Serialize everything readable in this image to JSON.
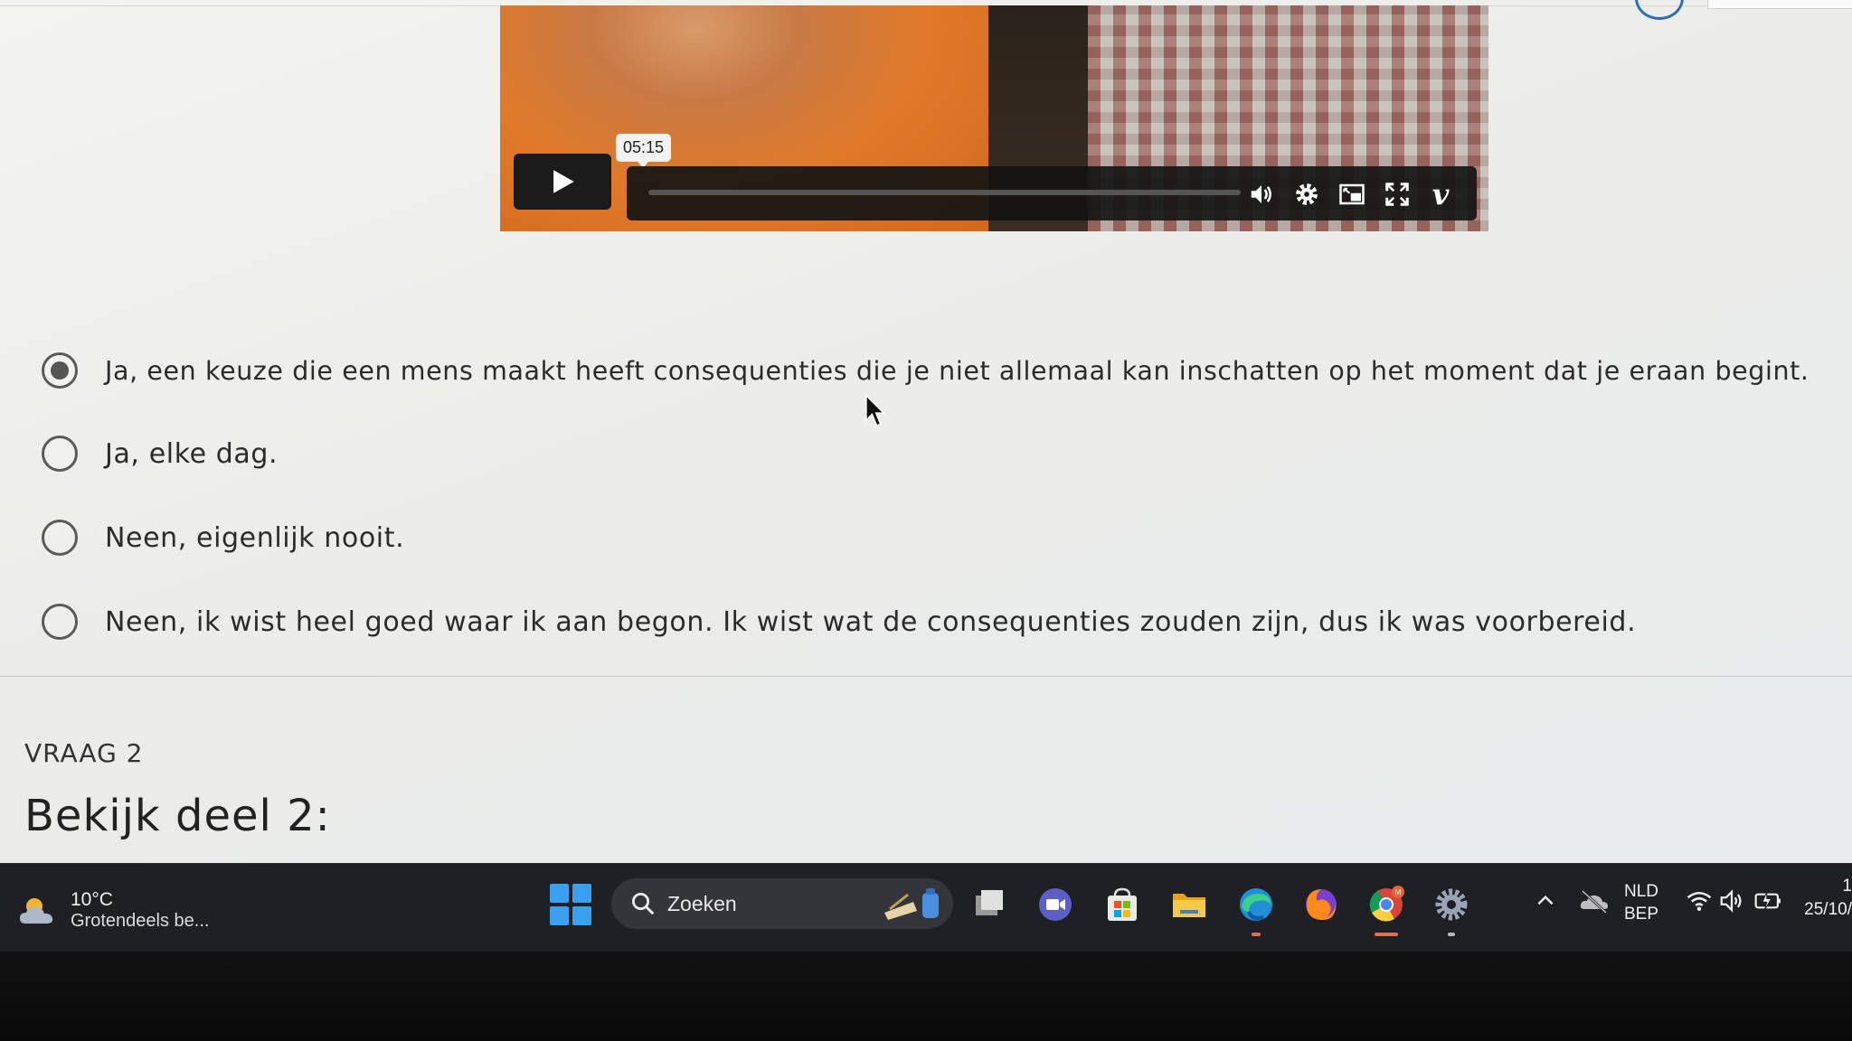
{
  "video": {
    "timestamp_tooltip": "05:15",
    "progress": 0.0,
    "controls": [
      "play",
      "volume",
      "settings",
      "picture-in-picture",
      "fullscreen",
      "vimeo"
    ],
    "vimeo_logo": "v"
  },
  "question1": {
    "options": [
      {
        "label": "Ja, een keuze die een mens maakt heeft consequenties die je niet allemaal kan inschatten op het moment dat je eraan begint.",
        "selected": true
      },
      {
        "label": "Ja, elke dag.",
        "selected": false
      },
      {
        "label": "Neen, eigenlijk nooit.",
        "selected": false
      },
      {
        "label": "Neen, ik wist heel goed waar ik aan begon. Ik wist wat de consequenties zouden zijn, dus ik was voorbereid.",
        "selected": false
      }
    ]
  },
  "question2": {
    "number_label": "VRAAG 2",
    "title": "Bekijk deel 2:"
  },
  "taskbar": {
    "weather": {
      "temperature": "10°C",
      "description": "Grotendeels be..."
    },
    "search": {
      "label": "Zoeken"
    },
    "apps": [
      "task-view",
      "teams-meet",
      "microsoft-store",
      "file-explorer",
      "edge",
      "firefox",
      "chrome",
      "settings"
    ],
    "language": {
      "line1": "NLD",
      "line2": "BEP"
    },
    "clock": {
      "time": "1",
      "date": "25/10/"
    }
  },
  "colors": {
    "accent_blue": "#2a6fb6",
    "taskbar_bg": "#1f2024",
    "windows_blue": "#3aa0f0"
  }
}
